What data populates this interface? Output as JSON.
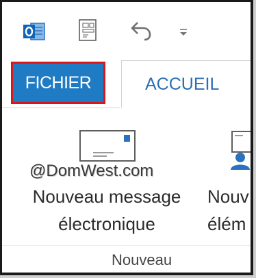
{
  "toolbar": {
    "icons": [
      "outlook-app-icon",
      "send-receive-icon",
      "undo-icon",
      "customize-toolbar-icon"
    ]
  },
  "tabs": {
    "fichier": "FICHIER",
    "accueil": "ACCUEIL"
  },
  "ribbon": {
    "email_label": "@DomWest.com",
    "new_message_line1": "Nouveau message",
    "new_message_line2": "électronique",
    "new_items_line1": "Nouv",
    "new_items_line2": "élém",
    "group_label": "Nouveau"
  },
  "colors": {
    "fichier_tab_bg": "#1f7bc4",
    "highlight_border": "#d81818",
    "accueil_text": "#2a6fb5",
    "outlook_blue": "#0f64b4"
  }
}
